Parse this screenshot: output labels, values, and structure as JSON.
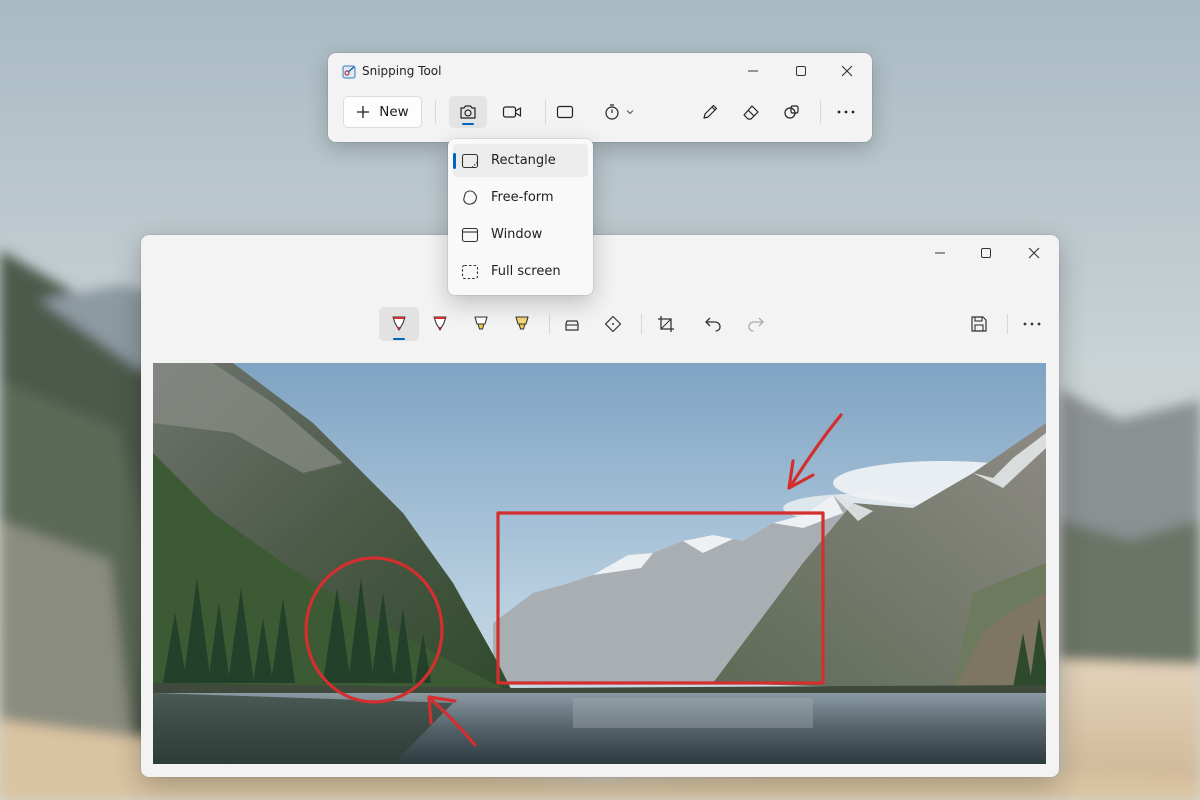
{
  "snipping_tool": {
    "title": "Snipping Tool",
    "new_label": "New",
    "icons": {
      "app": "snipping-tool-icon",
      "minimize": "minimize-icon",
      "maximize": "maximize-icon",
      "close": "close-icon",
      "new": "plus-icon",
      "screenshot_mode": "camera-icon",
      "record_mode": "video-camera-icon",
      "snip_shape": "rectangle-icon",
      "delay": "timer-icon",
      "delay_dropdown": "chevron-down-icon",
      "pen": "pencil-icon",
      "eraser": "eraser-icon",
      "shapes": "shapes-icon",
      "more": "more-icon"
    },
    "selected_mode": "screenshot"
  },
  "snip_mode_menu": {
    "items": [
      {
        "label": "Rectangle",
        "icon": "rectangle-snip-icon",
        "selected": true
      },
      {
        "label": "Free-form",
        "icon": "freeform-snip-icon",
        "selected": false
      },
      {
        "label": "Window",
        "icon": "window-snip-icon",
        "selected": false
      },
      {
        "label": "Full screen",
        "icon": "fullscreen-snip-icon",
        "selected": false
      }
    ]
  },
  "editor": {
    "tools": [
      {
        "name": "ballpoint-pen-red",
        "icon": "pen-red-icon",
        "active": true
      },
      {
        "name": "ballpoint-pen-red-2",
        "icon": "pen-red-icon",
        "active": false
      },
      {
        "name": "highlighter-yellow",
        "icon": "highlighter-icon",
        "active": false
      },
      {
        "name": "highlighter-yellow-2",
        "icon": "highlighter-icon",
        "active": false
      },
      {
        "name": "eraser",
        "icon": "eraser-icon",
        "active": false
      },
      {
        "name": "ruler",
        "icon": "ruler-icon",
        "active": false
      },
      {
        "name": "crop",
        "icon": "crop-icon",
        "active": false
      },
      {
        "name": "undo",
        "icon": "undo-icon",
        "active": false
      },
      {
        "name": "redo",
        "icon": "redo-icon",
        "active": false
      },
      {
        "name": "save",
        "icon": "save-icon",
        "active": false
      },
      {
        "name": "more",
        "icon": "more-icon",
        "active": false
      }
    ],
    "annotation_color": "#d32f2f",
    "accent_color": "#0067c0"
  }
}
